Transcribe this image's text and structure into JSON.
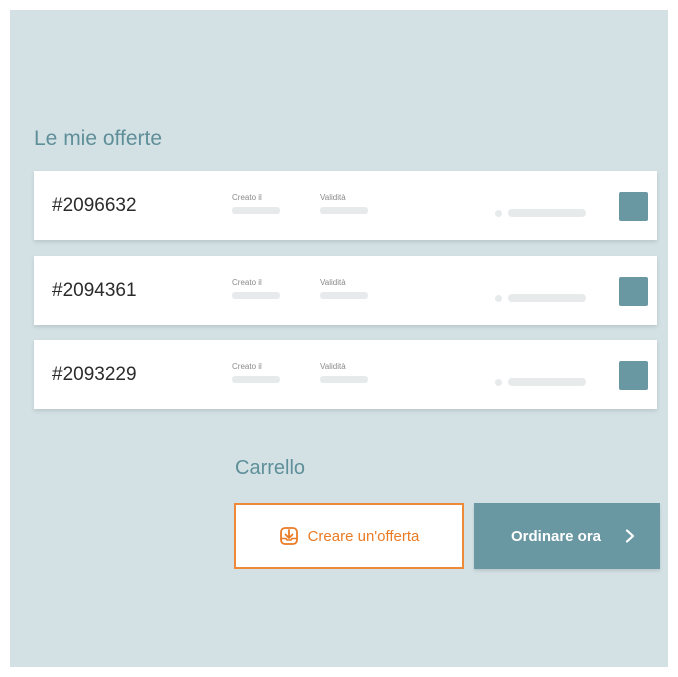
{
  "offers_section": {
    "title": "Le mie offerte",
    "created_label": "Creato il",
    "validity_label": "Validità",
    "items": [
      {
        "id": "#2096632"
      },
      {
        "id": "#2094361"
      },
      {
        "id": "#2093229"
      }
    ]
  },
  "cart": {
    "title": "Carrello",
    "create_offer_label": "Creare un'offerta",
    "order_now_label": "Ordinare ora",
    "create_offer_icon": "download-icon",
    "order_now_icon": "chevron-right-icon"
  },
  "colors": {
    "background": "#d3e1e5",
    "accent_teal": "#6a98a2",
    "accent_orange": "#ee8a37"
  }
}
